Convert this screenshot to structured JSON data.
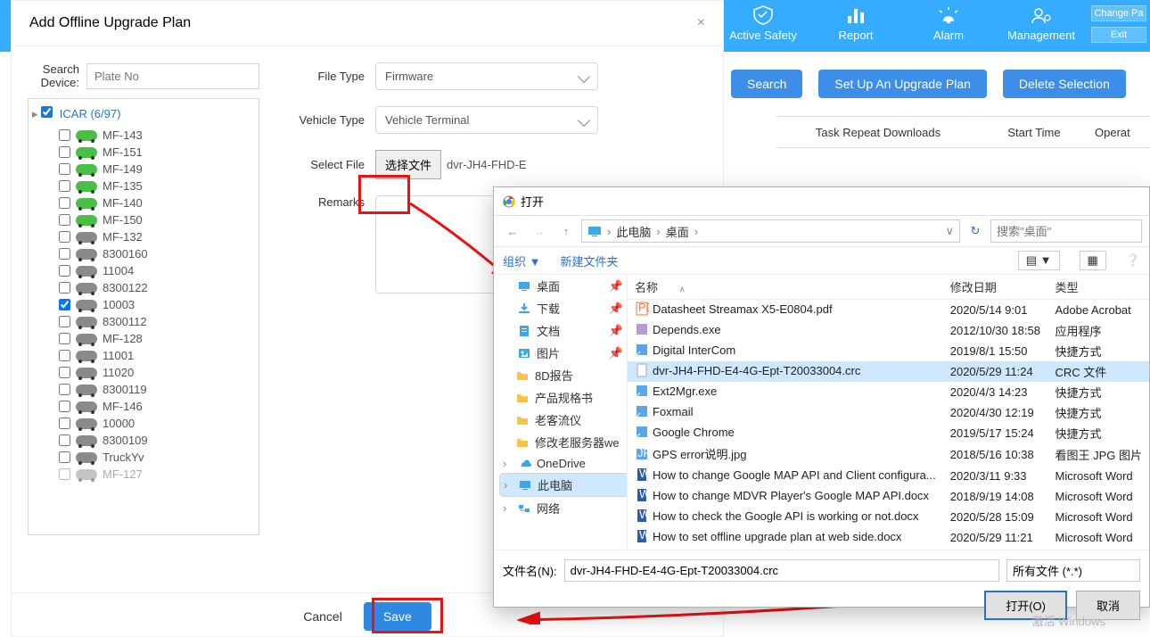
{
  "ribbon": {
    "items": [
      {
        "label": "Active Safety"
      },
      {
        "label": "Report"
      },
      {
        "label": "Alarm"
      },
      {
        "label": "Management"
      }
    ],
    "side": {
      "change": "Change Pa",
      "exit": "Exit"
    }
  },
  "toolbar": {
    "search": "Search",
    "setup": "Set Up An Upgrade Plan",
    "delete": "Delete Selection"
  },
  "grid": {
    "headers": [
      "Task Repeat Downloads",
      "Start Time",
      "Operat"
    ]
  },
  "modal": {
    "title": "Add Offline Upgrade Plan",
    "search_label": "Search Device:",
    "search_placeholder": "Plate No",
    "tree_root": "ICAR (6/97)",
    "tree": [
      {
        "name": "MF-143",
        "on": true,
        "ck": false
      },
      {
        "name": "MF-151",
        "on": true,
        "ck": false
      },
      {
        "name": "MF-149",
        "on": true,
        "ck": false
      },
      {
        "name": "MF-135",
        "on": true,
        "ck": false
      },
      {
        "name": "MF-140",
        "on": true,
        "ck": false
      },
      {
        "name": "MF-150",
        "on": true,
        "ck": false
      },
      {
        "name": "MF-132",
        "on": false,
        "ck": false
      },
      {
        "name": "8300160",
        "on": false,
        "ck": false
      },
      {
        "name": "11004",
        "on": false,
        "ck": false
      },
      {
        "name": "8300122",
        "on": false,
        "ck": false
      },
      {
        "name": "10003",
        "on": false,
        "ck": true
      },
      {
        "name": "8300112",
        "on": false,
        "ck": false
      },
      {
        "name": "MF-128",
        "on": false,
        "ck": false
      },
      {
        "name": "11001",
        "on": false,
        "ck": false
      },
      {
        "name": "11020",
        "on": false,
        "ck": false
      },
      {
        "name": "8300119",
        "on": false,
        "ck": false
      },
      {
        "name": "MF-146",
        "on": false,
        "ck": false
      },
      {
        "name": "10000",
        "on": false,
        "ck": false
      },
      {
        "name": "8300109",
        "on": false,
        "ck": false
      },
      {
        "name": "TruckYv",
        "on": false,
        "ck": false
      },
      {
        "name": "MF-127",
        "on": false,
        "ck": false,
        "half": true
      }
    ],
    "labels": {
      "file_type": "File Type",
      "vehicle_type": "Vehicle Type",
      "select_file": "Select File",
      "remarks": "Remarks"
    },
    "values": {
      "file_type": "Firmware",
      "vehicle_type": "Vehicle Terminal",
      "file_button": "选择文件",
      "file_name": "dvr-JH4-FHD-E"
    },
    "footer": {
      "cancel": "Cancel",
      "save": "Save"
    }
  },
  "opendlg": {
    "title": "打开",
    "breadcrumb": [
      "此电脑",
      "桌面"
    ],
    "refresh": "↻",
    "search_placeholder": "搜索\"桌面\"",
    "toolbar": {
      "org": "组织 ▼",
      "newf": "新建文件夹"
    },
    "side": [
      {
        "label": "桌面",
        "icon": "desktop",
        "pin": true,
        "sel": false
      },
      {
        "label": "下载",
        "icon": "download",
        "pin": true
      },
      {
        "label": "文档",
        "icon": "doc",
        "pin": true
      },
      {
        "label": "图片",
        "icon": "pic",
        "pin": true
      },
      {
        "label": "8D报告",
        "icon": "folder",
        "sub": true
      },
      {
        "label": "产品规格书",
        "icon": "folder",
        "sub": true
      },
      {
        "label": "老客流仪",
        "icon": "folder",
        "sub": true
      },
      {
        "label": "修改老服务器we",
        "icon": "folder",
        "sub": true
      },
      {
        "label": "OneDrive",
        "icon": "cloud",
        "exp": true
      },
      {
        "label": "此电脑",
        "icon": "pc",
        "sel": true,
        "exp": true
      },
      {
        "label": "网络",
        "icon": "net",
        "exp": true
      }
    ],
    "columns": {
      "name": "名称",
      "date": "修改日期",
      "type": "类型"
    },
    "files": [
      {
        "icon": "pdf",
        "name": "Datasheet Streamax X5-E0804.pdf",
        "date": "2020/5/14 9:01",
        "type": "Adobe Acrobat"
      },
      {
        "icon": "exe",
        "name": "Depends.exe",
        "date": "2012/10/30 18:58",
        "type": "应用程序"
      },
      {
        "icon": "lnk",
        "name": "Digital InterCom",
        "date": "2019/8/1 15:50",
        "type": "快捷方式"
      },
      {
        "icon": "file",
        "name": "dvr-JH4-FHD-E4-4G-Ept-T20033004.crc",
        "date": "2020/5/29 11:24",
        "type": "CRC 文件",
        "sel": true
      },
      {
        "icon": "lnk",
        "name": "Ext2Mgr.exe",
        "date": "2020/4/3 14:23",
        "type": "快捷方式"
      },
      {
        "icon": "lnk",
        "name": "Foxmail",
        "date": "2020/4/30 12:19",
        "type": "快捷方式"
      },
      {
        "icon": "lnk",
        "name": "Google Chrome",
        "date": "2019/5/17 15:24",
        "type": "快捷方式"
      },
      {
        "icon": "jpg",
        "name": "GPS error说明.jpg",
        "date": "2018/5/16 10:38",
        "type": "看图王 JPG 图片"
      },
      {
        "icon": "doc",
        "name": "How to change Google MAP API and Client configura...",
        "date": "2020/3/11 9:33",
        "type": "Microsoft Word"
      },
      {
        "icon": "doc",
        "name": "How to change MDVR Player's Google MAP API.docx",
        "date": "2018/9/19 14:08",
        "type": "Microsoft Word"
      },
      {
        "icon": "doc",
        "name": "How to check the Google API is working or not.docx",
        "date": "2020/5/28 15:09",
        "type": "Microsoft Word"
      },
      {
        "icon": "doc",
        "name": "How to set offline upgrade plan at web side.docx",
        "date": "2020/5/29 11:21",
        "type": "Microsoft Word"
      }
    ],
    "bottom": {
      "filename_label": "文件名(N):",
      "filename_value": "dvr-JH4-FHD-E4-4G-Ept-T20033004.crc",
      "filter": "所有文件 (*.*)",
      "open": "打开(O)",
      "cancel": "取消"
    }
  },
  "watermark": {
    "line1": "激活 Windows"
  }
}
